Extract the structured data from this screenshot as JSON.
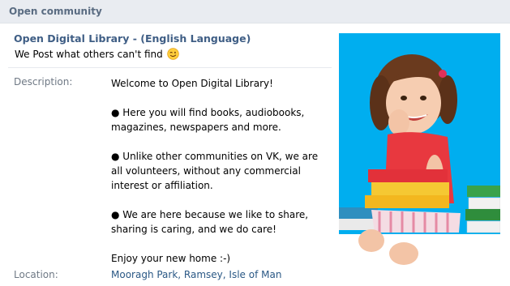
{
  "header": {
    "title": "Open community"
  },
  "group": {
    "name": "Open Digital Library - (English Language)",
    "status": "We Post what others can't find"
  },
  "description": {
    "label": "Description:",
    "paragraphs": [
      "Welcome to Open Digital Library!",
      "● Here you will find books, audiobooks, magazines, newspapers and more.",
      "● Unlike other communities on VK, we are all volunteers, without any commercial interest or affiliation.",
      "● We are here because we like to share, sharing is caring, and we do care!",
      "Enjoy your new home :-)"
    ]
  },
  "location": {
    "label": "Location:",
    "value": "Mooragh Park, Ramsey, Isle of Man"
  },
  "colors": {
    "header_bg": "#e9ecf1",
    "title_text": "#3f5e85",
    "link": "#2a5885",
    "label": "#6f7985",
    "cover_bg": "#00aeef"
  },
  "icons": {
    "status_emoji": "winking-face-icon"
  }
}
